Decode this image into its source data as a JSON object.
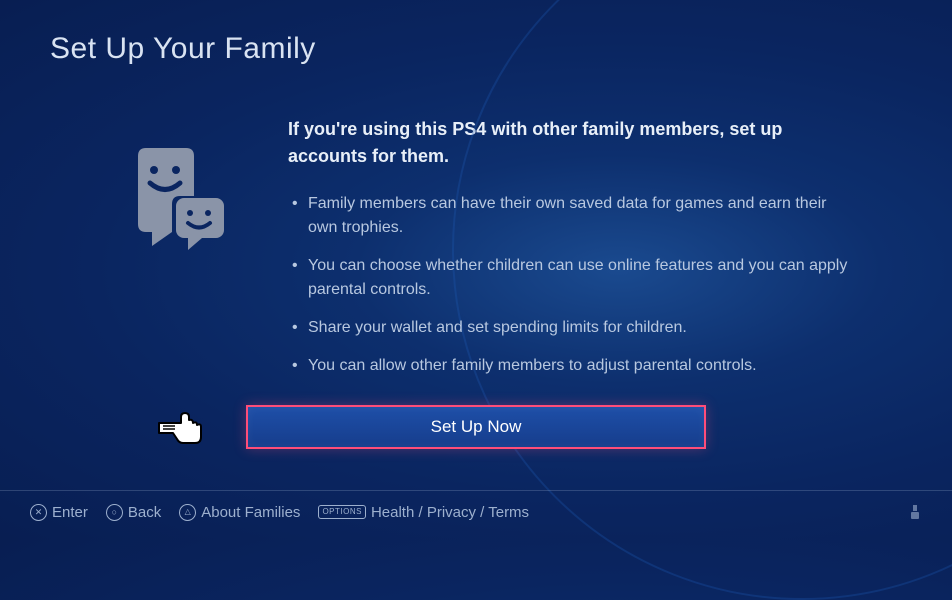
{
  "header": {
    "title": "Set Up Your Family"
  },
  "content": {
    "intro": "If you're using this PS4 with other family members, set up accounts for them.",
    "bullets": [
      "Family members can have their own saved data for games and earn their own trophies.",
      "You can choose whether children can use online features and you can apply parental controls.",
      "Share your wallet and set spending limits for children.",
      "You can allow other family members to adjust parental controls."
    ]
  },
  "action": {
    "primary_label": "Set Up Now"
  },
  "footer": {
    "enter": "Enter",
    "back": "Back",
    "about": "About Families",
    "options_badge": "OPTIONS",
    "legal": "Health / Privacy / Terms"
  }
}
